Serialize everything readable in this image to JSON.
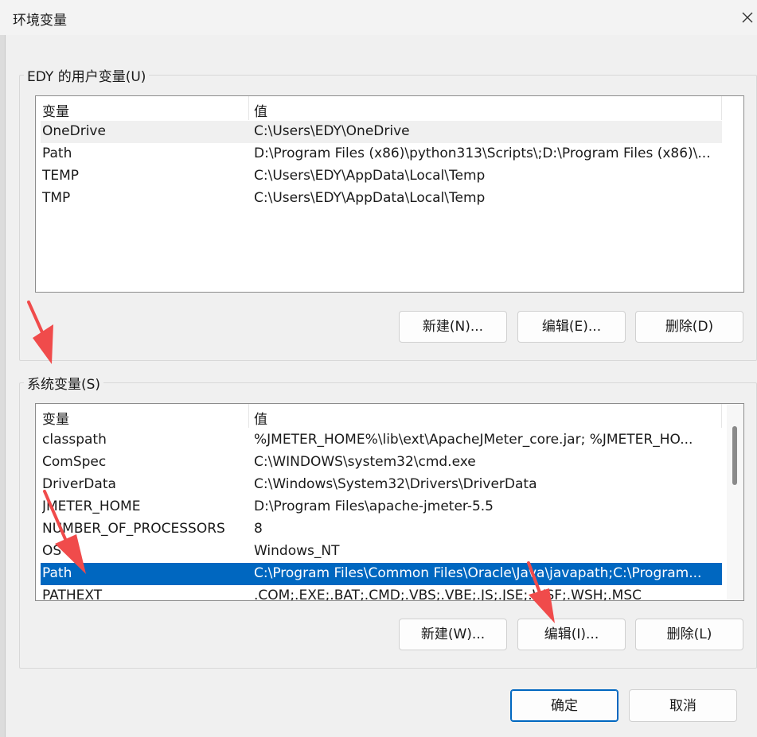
{
  "window": {
    "title": "环境变量"
  },
  "user_vars": {
    "group_label": "EDY 的用户变量(U)",
    "col_name": "变量",
    "col_value": "值",
    "rows": [
      {
        "name": "OneDrive",
        "value": "C:\\Users\\EDY\\OneDrive"
      },
      {
        "name": "Path",
        "value": "D:\\Program Files (x86)\\python313\\Scripts\\;D:\\Program Files (x86)\\..."
      },
      {
        "name": "TEMP",
        "value": "C:\\Users\\EDY\\AppData\\Local\\Temp"
      },
      {
        "name": "TMP",
        "value": "C:\\Users\\EDY\\AppData\\Local\\Temp"
      }
    ],
    "buttons": {
      "new": "新建(N)...",
      "edit": "编辑(E)...",
      "delete": "删除(D)"
    }
  },
  "system_vars": {
    "group_label": "系统变量(S)",
    "col_name": "变量",
    "col_value": "值",
    "rows": [
      {
        "name": "classpath",
        "value": "%JMETER_HOME%\\lib\\ext\\ApacheJMeter_core.jar; %JMETER_HO..."
      },
      {
        "name": "ComSpec",
        "value": "C:\\WINDOWS\\system32\\cmd.exe"
      },
      {
        "name": "DriverData",
        "value": "C:\\Windows\\System32\\Drivers\\DriverData"
      },
      {
        "name": "JMETER_HOME",
        "value": "D:\\Program Files\\apache-jmeter-5.5"
      },
      {
        "name": "NUMBER_OF_PROCESSORS",
        "value": "8"
      },
      {
        "name": "OS",
        "value": "Windows_NT"
      },
      {
        "name": "Path",
        "value": "C:\\Program Files\\Common Files\\Oracle\\Java\\javapath;C:\\Program..."
      },
      {
        "name": "PATHEXT",
        "value": ".COM;.EXE;.BAT;.CMD;.VBS;.VBE;.JS;.JSE;.WSF;.WSH;.MSC"
      }
    ],
    "selected_row": "Path",
    "buttons": {
      "new": "新建(W)...",
      "edit": "编辑(I)...",
      "delete": "删除(L)"
    }
  },
  "footer": {
    "ok": "确定",
    "cancel": "取消"
  },
  "colors": {
    "selection": "#0067c0",
    "annotation_arrow": "#f04b4b"
  }
}
